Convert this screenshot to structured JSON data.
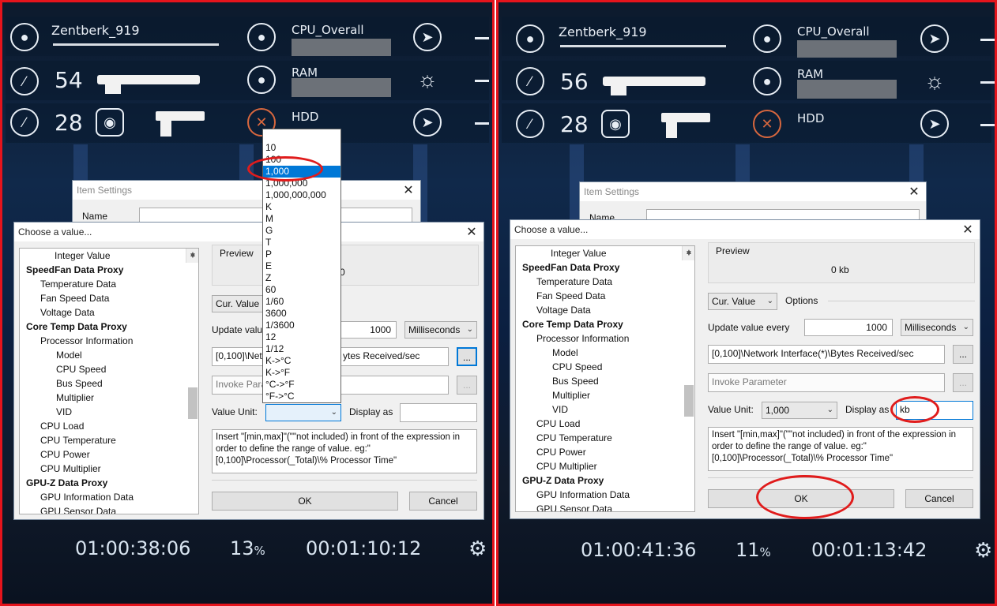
{
  "left": {
    "hud": {
      "username": "Zentberk_919",
      "ammo_primary": "54",
      "ammo_secondary": "28",
      "cpu_label": "CPU_Overall",
      "ram_label": "RAM",
      "hdd_label": "HDD",
      "time_elapsed": "01:00:38:06",
      "percent": "13",
      "percent_sign": "%",
      "time_remaining": "00:01:10:12"
    },
    "item_settings": {
      "title": "Item Settings",
      "name_label": "Name"
    },
    "dialog": {
      "title": "Choose a value...",
      "tree": [
        "Integer Value",
        "SpeedFan Data Proxy",
        "Temperature Data",
        "Fan Speed Data",
        "Voltage Data",
        "Core Temp Data Proxy",
        "Processor Information",
        "Model",
        "CPU Speed",
        "Bus Speed",
        "Multiplier",
        "VID",
        "CPU Load",
        "CPU Temperature",
        "CPU Power",
        "CPU Multiplier",
        "GPU-Z Data Proxy",
        "GPU Information Data",
        "GPU Sensor Data"
      ],
      "preview_label": "Preview",
      "preview_value_partial": "0",
      "cur_value": "Cur. Value",
      "update_label": "Update value",
      "update_value": "1000",
      "update_unit": "Milliseconds",
      "path_left": "[0,100]\\Netw",
      "path_right": "ytes Received/sec",
      "browse": "...",
      "invoke_placeholder": "Invoke Para",
      "value_unit_label": "Value Unit:",
      "value_unit": "",
      "display_as_label": "Display as",
      "display_as_value": "",
      "note": "Insert \"[min,max]\"(\"\"not included) in front of the expression in order to define the range of value. eg:\"[0,100]\\Processor(_Total)\\% Processor Time\"",
      "ok": "OK",
      "cancel": "Cancel"
    },
    "unit_options": [
      "10",
      "100",
      "1,000",
      "1,000,000",
      "1,000,000,000",
      "K",
      "M",
      "G",
      "T",
      "P",
      "E",
      "Z",
      "60",
      "1/60",
      "3600",
      "1/3600",
      "12",
      "1/12",
      "K->°C",
      "K->°F",
      "°C->°F",
      "°F->°C"
    ],
    "unit_selected": "1,000"
  },
  "right": {
    "hud": {
      "username": "Zentberk_919",
      "ammo_primary": "56",
      "ammo_secondary": "28",
      "cpu_label": "CPU_Overall",
      "ram_label": "RAM",
      "hdd_label": "HDD",
      "time_elapsed": "01:00:41:36",
      "percent": "11",
      "percent_sign": "%",
      "time_remaining": "00:01:13:42"
    },
    "item_settings": {
      "title": "Item Settings",
      "name_label": "Name"
    },
    "dialog": {
      "title": "Choose a value...",
      "tree": [
        "Integer Value",
        "SpeedFan Data Proxy",
        "Temperature Data",
        "Fan Speed Data",
        "Voltage Data",
        "Core Temp Data Proxy",
        "Processor Information",
        "Model",
        "CPU Speed",
        "Bus Speed",
        "Multiplier",
        "VID",
        "CPU Load",
        "CPU Temperature",
        "CPU Power",
        "CPU Multiplier",
        "GPU-Z Data Proxy",
        "GPU Information Data",
        "GPU Sensor Data"
      ],
      "preview_label": "Preview",
      "preview_value": "0 kb",
      "cur_value": "Cur. Value",
      "options_label": "Options",
      "update_label": "Update value every",
      "update_value": "1000",
      "update_unit": "Milliseconds",
      "path": "[0,100]\\Network Interface(*)\\Bytes Received/sec",
      "browse": "...",
      "invoke_placeholder": "Invoke Parameter",
      "value_unit_label": "Value Unit:",
      "value_unit": "1,000",
      "display_as_label": "Display as",
      "display_as_value": "kb",
      "note": "Insert \"[min,max]\"(\"\"not included) in front of the expression in order to define the range of value. eg:\"[0,100]\\Processor(_Total)\\% Processor Time\"",
      "ok": "OK",
      "cancel": "Cancel"
    }
  },
  "colors": {
    "highlight": "#e01c1c",
    "selection": "#0078d7",
    "panel_border": "#e5141c"
  }
}
